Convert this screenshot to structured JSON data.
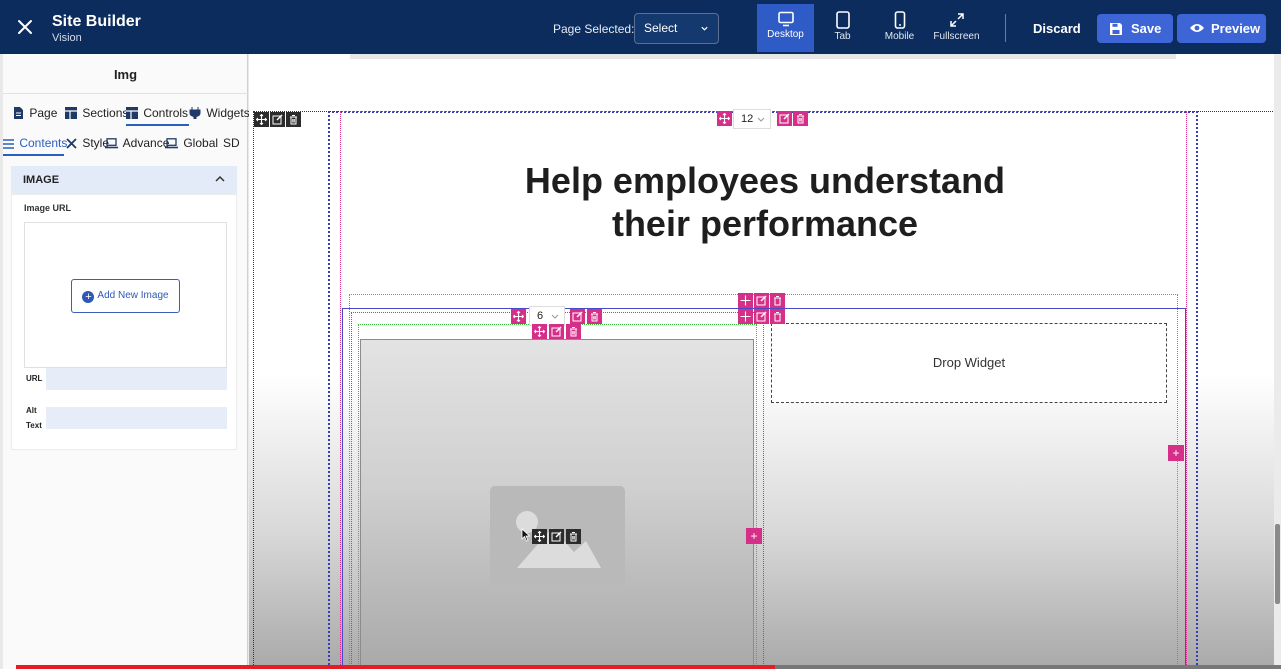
{
  "header": {
    "title": "Site Builder",
    "subtitle": "Vision",
    "page_selected_label": "Page Selected:",
    "page_select_value": "Select",
    "devices": [
      {
        "label": "Desktop",
        "active": true
      },
      {
        "label": "Tab",
        "active": false
      },
      {
        "label": "Mobile",
        "active": false
      },
      {
        "label": "Fullscreen",
        "active": false
      }
    ],
    "discard_label": "Discard",
    "save_label": "Save",
    "preview_label": "Preview"
  },
  "panel": {
    "title": "Img",
    "main_tabs": [
      {
        "label": "Page"
      },
      {
        "label": "Sections"
      },
      {
        "label": "Controls",
        "active": true
      },
      {
        "label": "Widgets"
      }
    ],
    "sub_tabs": [
      {
        "label": "Contents",
        "active": true
      },
      {
        "label": "Style"
      },
      {
        "label": "Advance"
      },
      {
        "label": "Global"
      },
      {
        "label": "SD"
      }
    ],
    "section_title": "IMAGE",
    "image_url_label": "Image URL",
    "add_image_label": "Add New Image",
    "url_label": "URL",
    "url_value": "",
    "alt_label_1": "Alt",
    "alt_label_2": "Text",
    "alt_value": ""
  },
  "canvas": {
    "headline_line1": "Help employees understand",
    "headline_line2": "their performance",
    "row_columns": "12",
    "inner_columns": "6",
    "drop_widget_label": "Drop Widget",
    "plus": "+"
  },
  "video_progress": 0.6,
  "colors": {
    "header_bg": "#0b2c5c",
    "accent_blue": "#3d65d6",
    "tool_pink": "#d62f8a"
  }
}
